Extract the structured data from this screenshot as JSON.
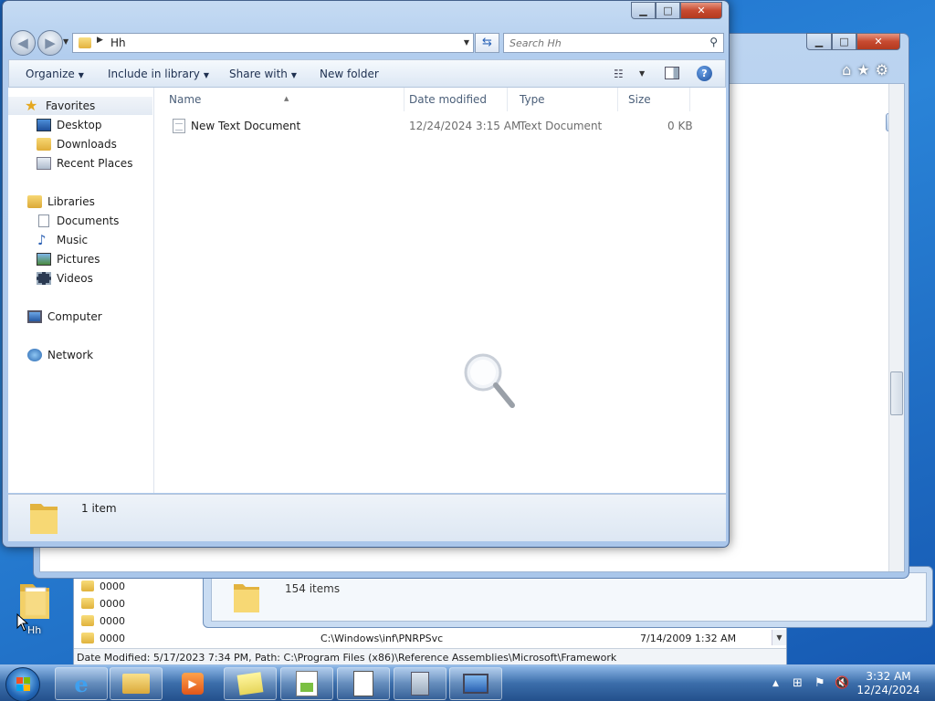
{
  "background_windows": {
    "list_rows": [
      {
        "name": "0000",
        "path": "",
        "date": ""
      },
      {
        "name": "0000",
        "path": "",
        "date": ""
      },
      {
        "name": "0000",
        "path": "",
        "date": ""
      },
      {
        "name": "0000",
        "path": "C:\\Windows\\inf\\PNRPSvc",
        "date": "7/14/2009 1:32 AM"
      }
    ],
    "status_text": "Date Modified: 5/17/2023 7:34 PM, Path: C:\\Program Files (x86)\\Reference Assemblies\\Microsoft\\Framework",
    "folder_window_count": "154 items"
  },
  "explorer": {
    "address_path": "Hh",
    "search_placeholder": "Search Hh",
    "commands": {
      "organize": "Organize",
      "include_in_library": "Include in library",
      "share_with": "Share with",
      "new_folder": "New folder"
    },
    "nav": {
      "favorites": "Favorites",
      "desktop": "Desktop",
      "downloads": "Downloads",
      "recent_places": "Recent Places",
      "libraries": "Libraries",
      "documents": "Documents",
      "music": "Music",
      "pictures": "Pictures",
      "videos": "Videos",
      "computer": "Computer",
      "network": "Network"
    },
    "columns": {
      "name": "Name",
      "date_modified": "Date modified",
      "type": "Type",
      "size": "Size"
    },
    "files": [
      {
        "name": "New Text Document",
        "date_modified": "12/24/2024 3:15 AM",
        "type": "Text Document",
        "size": "0 KB"
      }
    ],
    "item_count": "1 item"
  },
  "desktop_icon_label": "Hh",
  "taskbar": {
    "clock_time": "3:32 AM",
    "clock_date": "12/24/2024"
  },
  "colors": {
    "accent": "#1b6ac9",
    "close_button": "#c74a30",
    "taskbar": "#2a5a96"
  }
}
